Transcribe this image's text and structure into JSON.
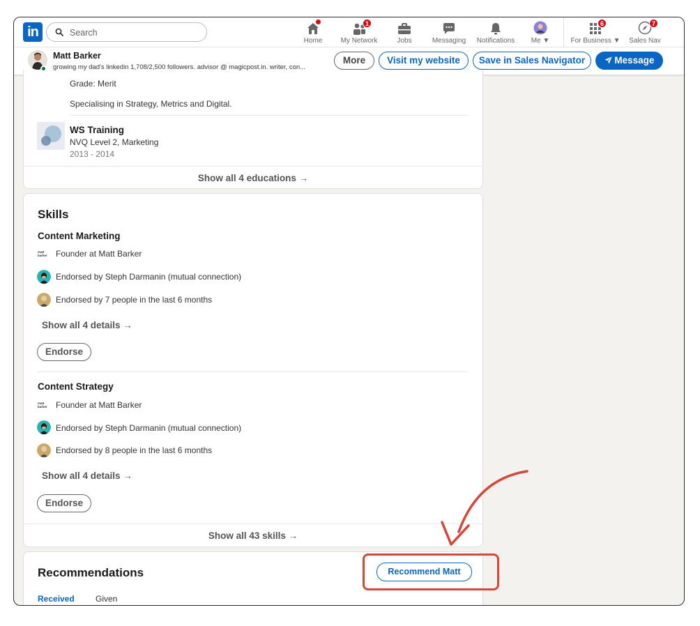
{
  "nav": {
    "logo_text": "in",
    "search_placeholder": "Search",
    "items": [
      {
        "label": "Home",
        "icon": "home-icon",
        "badge": ""
      },
      {
        "label": "My Network",
        "icon": "people-icon",
        "badge": "1"
      },
      {
        "label": "Jobs",
        "icon": "briefcase-icon",
        "badge": ""
      },
      {
        "label": "Messaging",
        "icon": "chat-icon",
        "badge": ""
      },
      {
        "label": "Notifications",
        "icon": "bell-icon",
        "badge": ""
      },
      {
        "label": "Me",
        "icon": "avatar-icon",
        "badge": ""
      },
      {
        "label": "For Business",
        "icon": "grid-icon",
        "badge": "6"
      },
      {
        "label": "Sales Nav",
        "icon": "compass-icon",
        "badge": "7"
      }
    ]
  },
  "profile_bar": {
    "name": "Matt Barker",
    "headline": "growing my dad's linkedin 1,708/2,500 followers. advisor @ magicpost.in. writer, con...",
    "more_label": "More",
    "visit_label": "Visit my website",
    "save_label": "Save in Sales Navigator",
    "message_label": "Message"
  },
  "education": {
    "grade": "Grade: Merit",
    "description": "Specialising in Strategy, Metrics and Digital.",
    "school": "WS Training",
    "degree": "NVQ Level 2, Marketing",
    "years": "2013 - 2014",
    "show_all": "Show all 4 educations →"
  },
  "skills": {
    "title": "Skills",
    "items": [
      {
        "name": "Content Marketing",
        "org": "Founder at Matt Barker",
        "org_logo": "matt barker",
        "endorsed_mutual": "Endorsed by Steph Darmanin (mutual connection)",
        "endorsed_count": "Endorsed by 7 people in the last 6 months",
        "show_details": "Show all 4 details →",
        "endorse_label": "Endorse"
      },
      {
        "name": "Content Strategy",
        "org": "Founder at Matt Barker",
        "org_logo": "matt barker",
        "endorsed_mutual": "Endorsed by Steph Darmanin (mutual connection)",
        "endorsed_count": "Endorsed by 8 people in the last 6 months",
        "show_details": "Show all 4 details →",
        "endorse_label": "Endorse"
      }
    ],
    "show_all": "Show all 43 skills →"
  },
  "recommendations": {
    "title": "Recommendations",
    "recommend_label": "Recommend Matt",
    "tab_received": "Received",
    "tab_given": "Given"
  },
  "colors": {
    "brand": "#0a66c2",
    "badge": "#cc1016",
    "annotation": "#d5473b",
    "background": "#f4f2ee"
  }
}
